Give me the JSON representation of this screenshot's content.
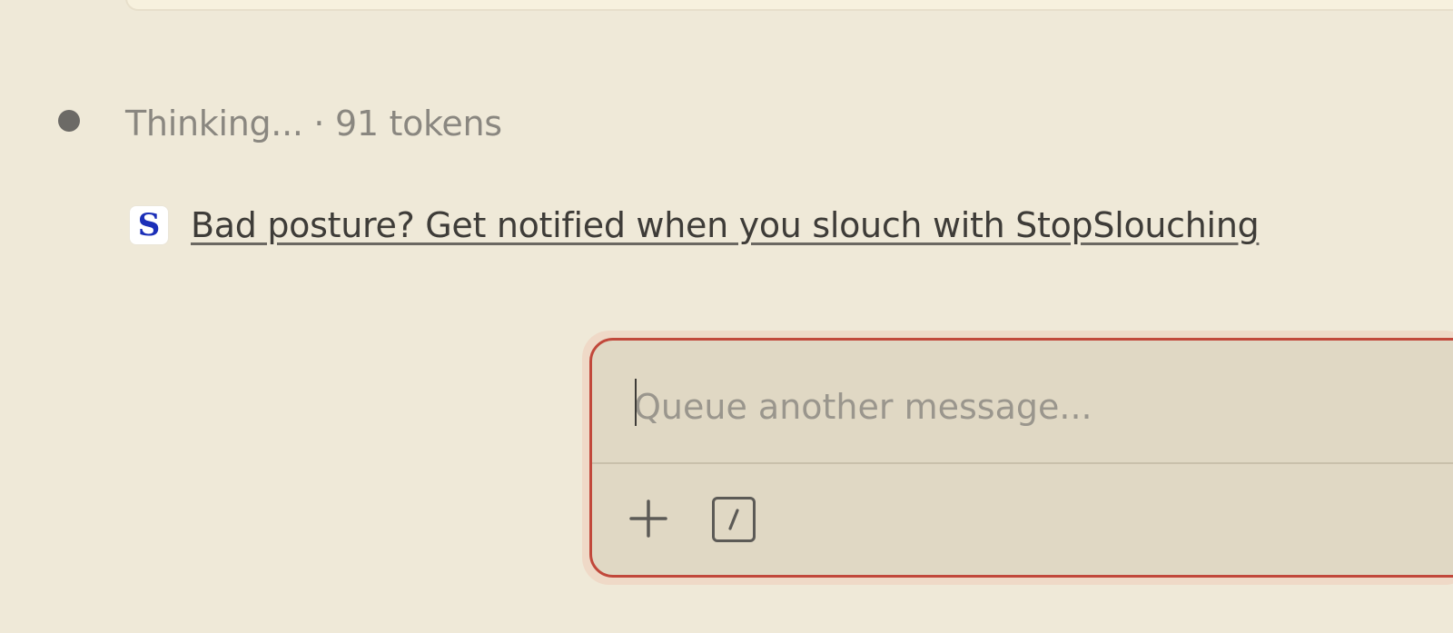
{
  "status": {
    "text": "Thinking... · 91 tokens"
  },
  "link": {
    "favicon_letter": "S",
    "text": "Bad posture? Get notified when you slouch with StopSlouching"
  },
  "composer": {
    "placeholder": "Queue another message...",
    "value": "",
    "accent_color": "#c1483b"
  },
  "icons": {
    "add": "plus-icon",
    "commands": "slash-command-icon"
  }
}
